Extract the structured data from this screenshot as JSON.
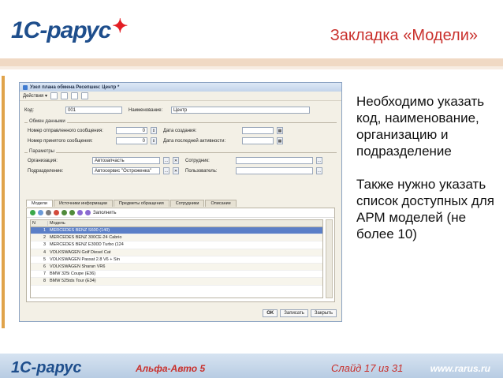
{
  "header": {
    "logo": "1С-рарус",
    "title": "Закладка «Модели»"
  },
  "window": {
    "title": "Узел плана обмена Ресепшен: Центр *",
    "actions_label": "Действия ▾",
    "code_label": "Код:",
    "code_value": "001",
    "name_label": "Наименование:",
    "name_value": "Центр",
    "group1_label": "Обмен данными",
    "sent_label": "Номер отправленного сообщения:",
    "sent_value": "0",
    "created_label": "Дата создания:",
    "recv_label": "Номер принятого сообщения:",
    "recv_value": "0",
    "last_label": "Дата последней активности:",
    "group2_label": "Параметры",
    "org_label": "Организация:",
    "org_value": "Автозапчасть",
    "emp_label": "Сотрудник:",
    "div_label": "Подразделение:",
    "div_value": "Автосервис \"Остроженка\"",
    "user_label": "Пользователь:",
    "tabs": [
      "Модели",
      "Источники информации",
      "Предметы обращения",
      "Сотрудники",
      "Описание"
    ],
    "fill_label": "Заполнить",
    "col_n": "N",
    "col_model": "Модель",
    "rows": [
      {
        "n": "1",
        "model": "MERCEDES BENZ S600 (140)"
      },
      {
        "n": "2",
        "model": "MERCEDES BENZ 300CE-24 Cabrio"
      },
      {
        "n": "3",
        "model": "MERCEDES BENZ E300D Turbo (124"
      },
      {
        "n": "4",
        "model": "VOLKSWAGEN Golf Diesel Cat"
      },
      {
        "n": "5",
        "model": "VOLKSWAGEN Passat 2.8 V6 + Sin"
      },
      {
        "n": "6",
        "model": "VOLKSWAGEN Sharan VR6"
      },
      {
        "n": "7",
        "model": "BMW 325i Coupe (E36)"
      },
      {
        "n": "8",
        "model": "BMW 525tds Tour (E34)"
      }
    ],
    "btn_ok": "OK",
    "btn_save": "Записать",
    "btn_close": "Закрыть"
  },
  "description": {
    "p1": "Необходимо указать код, наименование, организацию и подразделение",
    "p2": "Также нужно указать список доступных для АРМ моделей (не более 10)"
  },
  "footer": {
    "logo": "1С-рарус",
    "course": "Альфа-Авто 5",
    "slide": "Слайд 17 из 31",
    "url": "www.rarus.ru"
  }
}
